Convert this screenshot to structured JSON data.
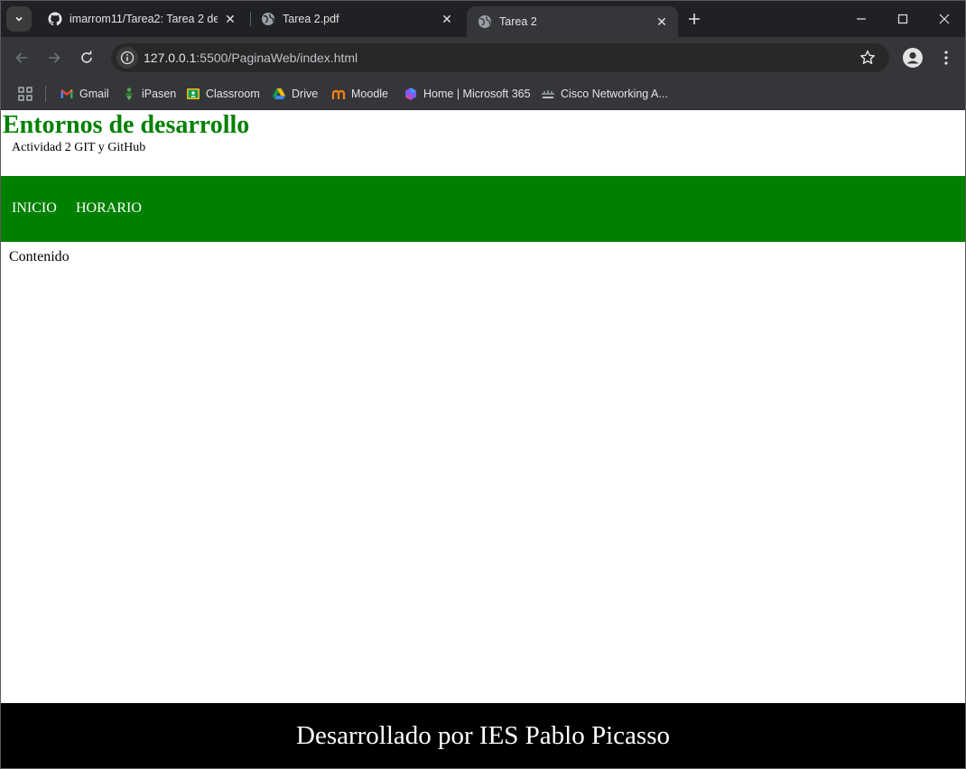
{
  "browser": {
    "tabs": [
      {
        "title": "imarrom11/Tarea2: Tarea 2 de G",
        "icon": "github-icon",
        "active": false
      },
      {
        "title": "Tarea 2.pdf",
        "icon": "globe-icon",
        "active": false
      },
      {
        "title": "Tarea 2",
        "icon": "globe-icon",
        "active": true
      }
    ],
    "url": {
      "host": "127.0.0.1",
      "path": ":5500/PaginaWeb/index.html"
    },
    "bookmarks": [
      {
        "label": "Gmail",
        "icon": "gmail-icon"
      },
      {
        "label": "iPasen",
        "icon": "ipasen-icon"
      },
      {
        "label": "Classroom",
        "icon": "classroom-icon"
      },
      {
        "label": "Drive",
        "icon": "drive-icon"
      },
      {
        "label": "Moodle",
        "icon": "moodle-icon"
      },
      {
        "label": "Home | Microsoft 365",
        "icon": "microsoft365-icon"
      },
      {
        "label": "Cisco Networking A...",
        "icon": "cisco-icon"
      }
    ],
    "colors": {
      "tabstrip": "#202124",
      "toolbar": "#35363a",
      "omnibox": "#282828"
    }
  },
  "page": {
    "title": "Entornos de desarrollo",
    "subtitle": "Actividad 2 GIT y GitHub",
    "nav": {
      "inicio": "INICIO",
      "horario": "HORARIO"
    },
    "content": "Contenido",
    "footer": "Desarrollado por IES Pablo Picasso",
    "colors": {
      "accent": "#008000",
      "footer_bg": "#000000",
      "nav_text": "#ffffff"
    }
  }
}
